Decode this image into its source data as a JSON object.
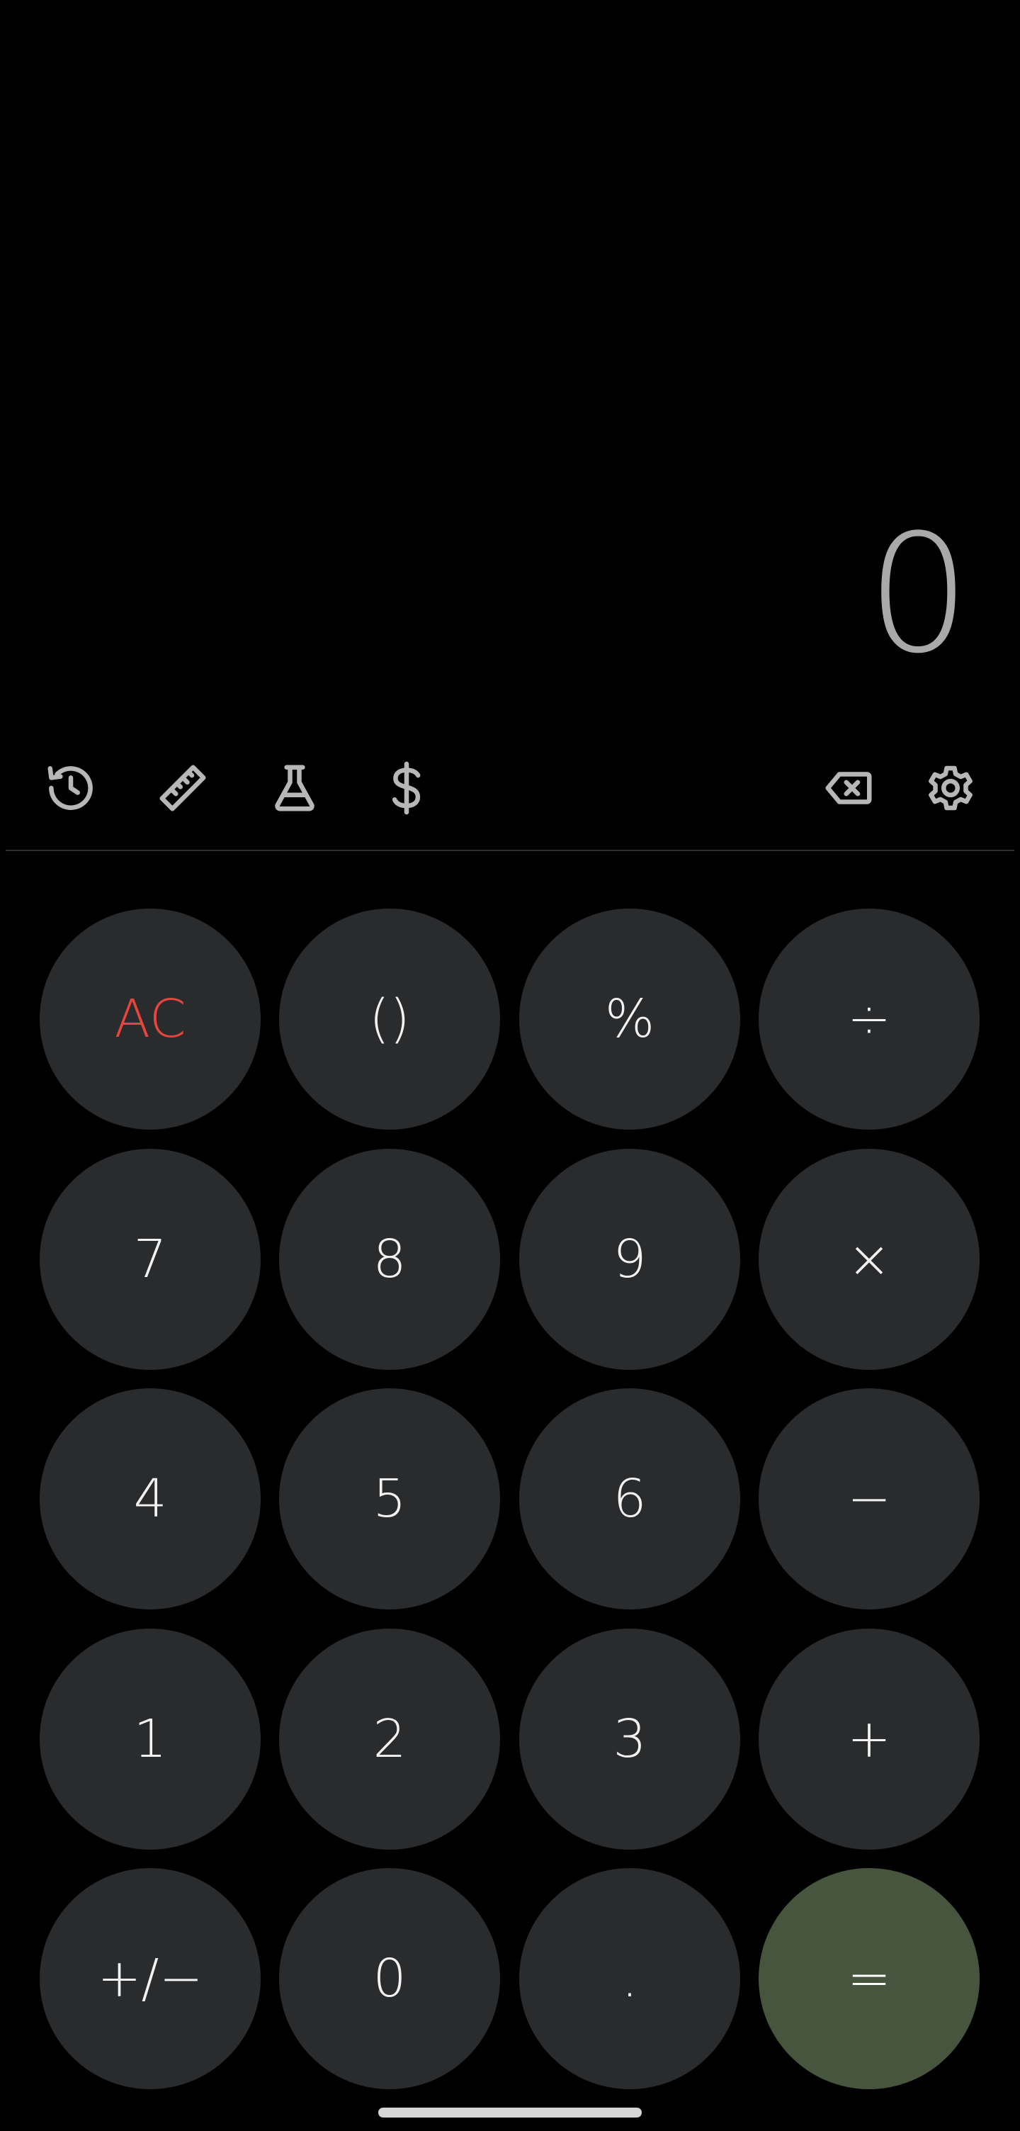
{
  "display": {
    "value": "0"
  },
  "toolbar": {
    "icons": [
      "history-icon",
      "ruler-icon",
      "flask-icon",
      "dollar-icon",
      "backspace-icon",
      "gear-icon"
    ]
  },
  "keypad": {
    "row1": [
      "AC",
      "()",
      "%",
      "÷"
    ],
    "row2": [
      "7",
      "8",
      "9",
      "×"
    ],
    "row3": [
      "4",
      "5",
      "6",
      "−"
    ],
    "row4": [
      "1",
      "2",
      "3",
      "+"
    ],
    "row5": [
      "+/−",
      "0",
      ".",
      "="
    ]
  },
  "colors": {
    "background": "#000000",
    "key": "#2a2b2d",
    "equals_key": "#48553e",
    "clear_text": "#e8453c",
    "display_text": "#a9a9a9",
    "icon": "#b7b7b7"
  }
}
